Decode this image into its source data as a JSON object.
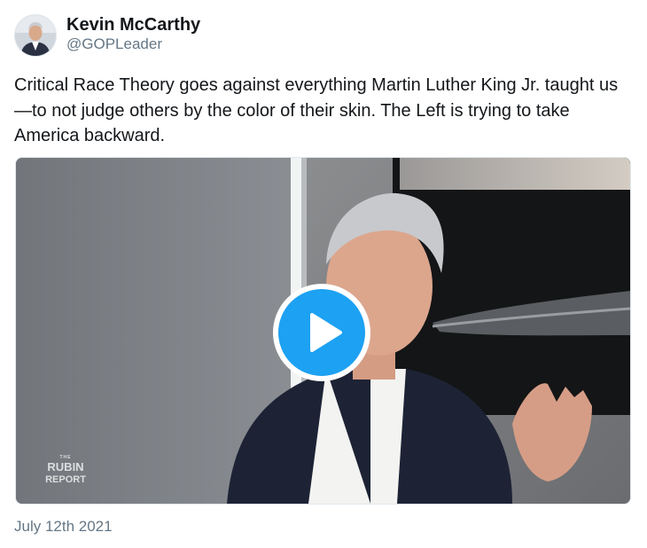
{
  "author": {
    "name": "Kevin McCarthy",
    "handle": "@GOPLeader",
    "avatar_icon": "profile-photo"
  },
  "tweet": {
    "text": "Critical Race Theory goes against everything Martin Luther King Jr. taught us—to not judge others by the color of their skin. The Left is trying to take America backward.",
    "date": "July 12th 2021"
  },
  "media": {
    "kind": "video",
    "play_icon": "play-icon",
    "watermark": {
      "line1": "THE",
      "line2": "RUBIN",
      "line3": "REPORT"
    }
  },
  "colors": {
    "accent": "#1da1f2",
    "text_primary": "#14171a",
    "text_secondary": "#657786"
  }
}
